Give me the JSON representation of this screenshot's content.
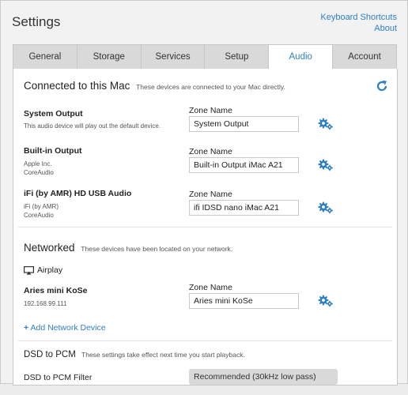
{
  "header": {
    "title": "Settings",
    "links": {
      "keyboard_shortcuts": "Keyboard Shortcuts",
      "about": "About"
    }
  },
  "tabs": [
    "General",
    "Storage",
    "Services",
    "Setup",
    "Audio",
    "Account"
  ],
  "active_tab": "Audio",
  "connected": {
    "title": "Connected to this Mac",
    "desc": "These devices are connected to your Mac directly.",
    "devices": [
      {
        "name": "System Output",
        "sub1": "This audio device will play out the default device.",
        "sub2": "",
        "zone_label": "Zone Name",
        "zone_value": "System Output"
      },
      {
        "name": "Built-in Output",
        "sub1": "Apple Inc.",
        "sub2": "CoreAudio",
        "zone_label": "Zone Name",
        "zone_value": "Built-in Output iMac A21"
      },
      {
        "name": "iFi (by AMR) HD USB Audio",
        "sub1": "iFi (by AMR)",
        "sub2": "CoreAudio",
        "zone_label": "Zone Name",
        "zone_value": "ifi IDSD nano iMac A21"
      }
    ]
  },
  "networked": {
    "title": "Networked",
    "desc": "These devices have been located on your network.",
    "group": "Airplay",
    "device": {
      "name": "Aries mini KoSe",
      "sub1": "192.168.99.111",
      "zone_label": "Zone Name",
      "zone_value": "Aries mini KoSe"
    },
    "add_link": "Add Network Device"
  },
  "dsd": {
    "title": "DSD to PCM",
    "desc": "These settings take effect next time you start playback.",
    "filter_label": "DSD to PCM Filter",
    "filter_value": "Recommended (30kHz low pass)"
  },
  "colors": {
    "accent": "#2f7fc4",
    "tab_inactive": "#d9d9d9"
  },
  "icons": {
    "refresh": "refresh-icon",
    "gear": "gear-icon",
    "airplay": "airplay-icon",
    "plus": "plus-icon"
  }
}
